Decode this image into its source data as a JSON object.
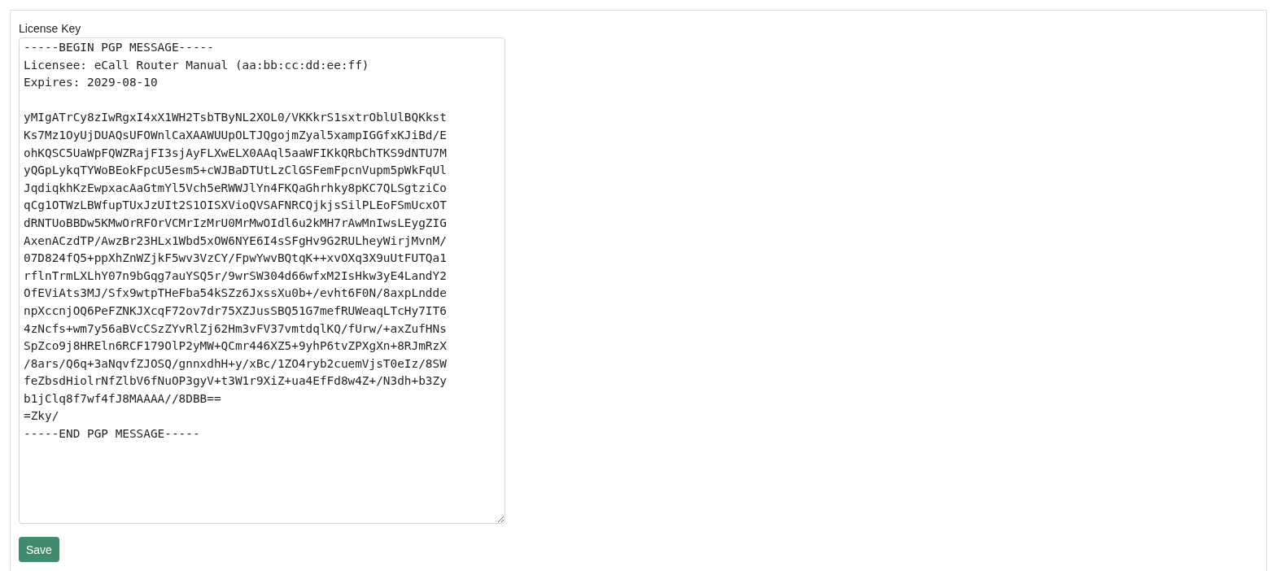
{
  "license_key": {
    "label": "License Key",
    "value": "-----BEGIN PGP MESSAGE-----\nLicensee: eCall Router Manual (aa:bb:cc:dd:ee:ff)\nExpires: 2029-08-10\n\nyMIgATrCy8zIwRgxI4xX1WH2TsbTByNL2XOL0/VKKkrS1sxtrOblUlBQKkst\nKs7Mz1OyUjDUAQsUFOWnlCaXAAWUUpOLTJQgojmZyal5xampIGGfxKJiBd/E\nohKQSC5UaWpFQWZRajFI3sjAyFLXwELX0AAql5aaWFIKkQRbChTKS9dNTU7M\nyQGpLykqTYWoBEokFpcU5esm5+cWJBaDTUtLzClGSFemFpcnVupm5pWkFqUl\nJqdiqkhKzEwpxacAaGtmYl5Vch5eRWWJlYn4FKQaGhrhky8pKC7QLSgtziCo\nqCg1OTWzLBWfupTUxJzUIt2S1OISXVioQVSAFNRCQjkjsSilPLEoFSmUcxOT\ndRNTUoBBDw5KMwOrRFOrVCMrIzMrU0MrMwOIdl6u2kMH7rAwMnIwsLEygZIG\nAxenACzdTP/AwzBr23HLx1Wbd5xOW6NYE6I4sSFgHv9G2RULheyWirjMvnM/\n07D824fQ5+ppXhZnWZjkF5wv3VzCY/FpwYwvBQtqK++xvOXq3X9uUtFUTQa1\nrflnTrmLXLhY07n9bGqg7auYSQ5r/9wrSW304d66wfxM2IsHkw3yE4LandY2\nOfEViAts3MJ/Sfx9wtpTHeFba54kSZz6JxssXu0b+/evht6F0N/8axpLndde\nnpXccnjOQ6PeFZNKJXcqF72ov7dr75XZJusSBQ51G7mefRUWeaqLTcHy7IT6\n4zNcfs+wm7y56aBVcCSzZYvRlZj62Hm3vFV37vmtdqlKQ/fUrw/+axZufHNs\nSpZco9j8HREln6RCF179OlP2yMW+QCmr446XZ5+9yhP6tvZPXgXn+8RJmRzX\n/8ars/Q6q+3aNqvfZJOSQ/gnnxdhH+y/xBc/1ZO4ryb2cuemVjsT0eIz/8SW\nfeZbsdHiolrNfZlbV6fNuOP3gyV+t3W1r9XiZ+ua4EfFd8w4Z+/N3dh+b3Zy\nb1jClq8f7wf4fJ8MAAAA//8DBB==\n=Zky/\n-----END PGP MESSAGE-----"
  },
  "save_button": {
    "label": "Save"
  }
}
